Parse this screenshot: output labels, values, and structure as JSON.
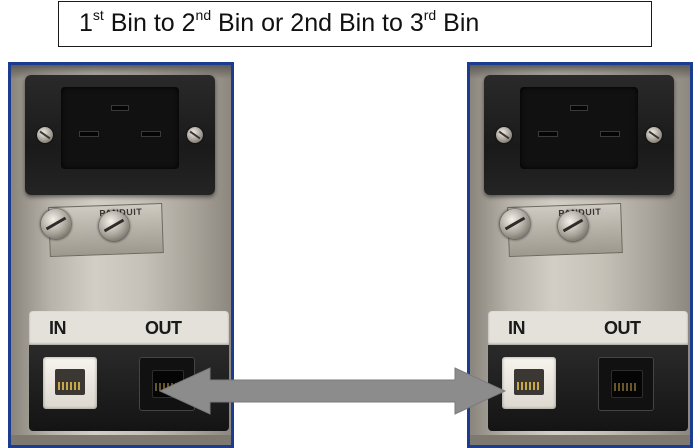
{
  "title": {
    "n1": "1",
    "s1": "st",
    "t1": " Bin to 2",
    "s2": "nd",
    "t2": " Bin or 2nd Bin to 3",
    "s3": "rd",
    "t3": " Bin"
  },
  "panels": [
    {
      "in_label": "IN",
      "out_label": "OUT"
    },
    {
      "in_label": "IN",
      "out_label": "OUT"
    }
  ],
  "colors": {
    "panel_border": "#1c3d8f",
    "arrow": "#8c8c8c"
  },
  "arrow_icon": "double-headed-arrow-icon"
}
